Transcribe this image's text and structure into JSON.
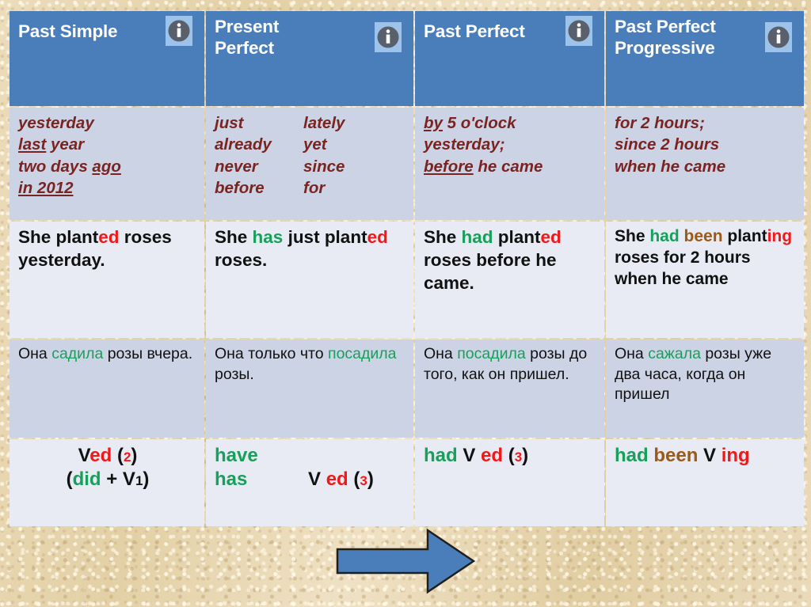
{
  "slide": {
    "background_color": "#e8d7b2",
    "accent_color": "#4a7ebb",
    "marker_text_color": "#7a2421",
    "highlight_green": "#18a05a",
    "highlight_red": "#f01818",
    "highlight_brown": "#9a5a18"
  },
  "table": {
    "columns": [
      {
        "id": "past-simple",
        "title": "Past Simple",
        "info_icon": "info-icon"
      },
      {
        "id": "present-perfect",
        "title": "Present\nPerfect",
        "info_icon": "info-icon"
      },
      {
        "id": "past-perfect",
        "title": "Past Perfect",
        "info_icon": "info-icon"
      },
      {
        "id": "past-perfect-progressive",
        "title": "Past Perfect\nProgressive",
        "info_icon": "info-icon"
      }
    ],
    "rows": {
      "markers": {
        "past_simple": {
          "lines": [
            "yesterday",
            "last year",
            "two days ago",
            "in 2012"
          ],
          "underlined": [
            "last",
            "ago",
            "in 2012"
          ]
        },
        "present_perfect": {
          "col_a": [
            "just",
            "already",
            "never",
            "before"
          ],
          "col_b": [
            "lately",
            "yet",
            "since",
            "for"
          ]
        },
        "past_perfect": {
          "lines": [
            "by 5 o'clock",
            "yesterday;",
            "before he came"
          ],
          "underlined": [
            "by",
            "before"
          ]
        },
        "past_perfect_progressive": {
          "lines": [
            "for  2 hours;",
            "since 2 hours",
            "when he came"
          ],
          "underlined": []
        }
      },
      "english": {
        "past_simple": {
          "parts": [
            {
              "t": "She  plant",
              "c": "black"
            },
            {
              "t": "ed",
              "c": "red"
            },
            {
              "t": " roses yesterday.",
              "c": "black"
            }
          ]
        },
        "present_perfect": {
          "parts": [
            {
              "t": "She ",
              "c": "black"
            },
            {
              "t": "has",
              "c": "green"
            },
            {
              "t": " just plant",
              "c": "black"
            },
            {
              "t": "ed",
              "c": "red"
            },
            {
              "t": " roses.",
              "c": "black"
            }
          ]
        },
        "past_perfect": {
          "parts": [
            {
              "t": "She ",
              "c": "black"
            },
            {
              "t": "had",
              "c": "green"
            },
            {
              "t": " plant",
              "c": "black"
            },
            {
              "t": "ed",
              "c": "red"
            },
            {
              "t": " roses before he came.",
              "c": "black"
            }
          ]
        },
        "past_perfect_progressive": {
          "parts": [
            {
              "t": "She ",
              "c": "black"
            },
            {
              "t": "had",
              "c": "green"
            },
            {
              "t": " ",
              "c": "black"
            },
            {
              "t": "been",
              "c": "brown"
            },
            {
              "t": " plant",
              "c": "black"
            },
            {
              "t": "ing",
              "c": "red"
            },
            {
              "t": " roses for 2 hours when he came",
              "c": "black"
            }
          ]
        }
      },
      "russian": {
        "past_simple": {
          "parts": [
            {
              "t": "Она ",
              "c": "black"
            },
            {
              "t": "садила",
              "c": "green"
            },
            {
              "t": " розы вчера.",
              "c": "black"
            }
          ]
        },
        "present_perfect": {
          "parts": [
            {
              "t": "Она только что ",
              "c": "black"
            },
            {
              "t": "посадила",
              "c": "green"
            },
            {
              "t": " розы.",
              "c": "black"
            }
          ]
        },
        "past_perfect": {
          "parts": [
            {
              "t": "Она  ",
              "c": "black"
            },
            {
              "t": "посадила",
              "c": "green"
            },
            {
              "t": " розы до того, как он пришел.",
              "c": "black"
            }
          ]
        },
        "past_perfect_progressive": {
          "parts": [
            {
              "t": "Она ",
              "c": "black"
            },
            {
              "t": "сажала",
              "c": "green"
            },
            {
              "t": " розы уже два часа, когда он пришел",
              "c": "black"
            }
          ]
        }
      },
      "formula": {
        "past_simple": {
          "line1": [
            {
              "t": "V",
              "c": "black"
            },
            {
              "t": "ed",
              "c": "red"
            },
            {
              "t": " (",
              "c": "black"
            },
            {
              "t": "2",
              "c": "red",
              "sub": true
            },
            {
              "t": ")",
              "c": "black"
            }
          ],
          "line2": [
            {
              "t": "(",
              "c": "black"
            },
            {
              "t": "did",
              "c": "green"
            },
            {
              "t": " + V",
              "c": "black"
            },
            {
              "t": "1",
              "c": "black",
              "sub": true
            },
            {
              "t": ")",
              "c": "black"
            }
          ]
        },
        "present_perfect": {
          "line1_left": [
            {
              "t": "have",
              "c": "green"
            }
          ],
          "line1_right": [],
          "line2_left": [
            {
              "t": "has",
              "c": "green"
            }
          ],
          "line2_right": [
            {
              "t": "V ",
              "c": "black"
            },
            {
              "t": "ed",
              "c": "red"
            },
            {
              "t": " (",
              "c": "black"
            },
            {
              "t": "3",
              "c": "red",
              "sub": true
            },
            {
              "t": ")",
              "c": "black"
            }
          ]
        },
        "past_perfect": {
          "parts": [
            {
              "t": "had",
              "c": "green"
            },
            {
              "t": "    V ",
              "c": "black"
            },
            {
              "t": "ed",
              "c": "red"
            },
            {
              "t": " (",
              "c": "black"
            },
            {
              "t": "3",
              "c": "red",
              "sub": true
            },
            {
              "t": ")",
              "c": "black"
            }
          ]
        },
        "past_perfect_progressive": {
          "parts": [
            {
              "t": "had",
              "c": "green"
            },
            {
              "t": " ",
              "c": "black"
            },
            {
              "t": "been",
              "c": "brown"
            },
            {
              "t": " V ",
              "c": "black"
            },
            {
              "t": "ing",
              "c": "red"
            }
          ]
        }
      }
    }
  },
  "arrow": {
    "name": "right-arrow",
    "direction": "right",
    "fill_color": "#4a7ebb",
    "outline_color": "#1f1f1f"
  }
}
